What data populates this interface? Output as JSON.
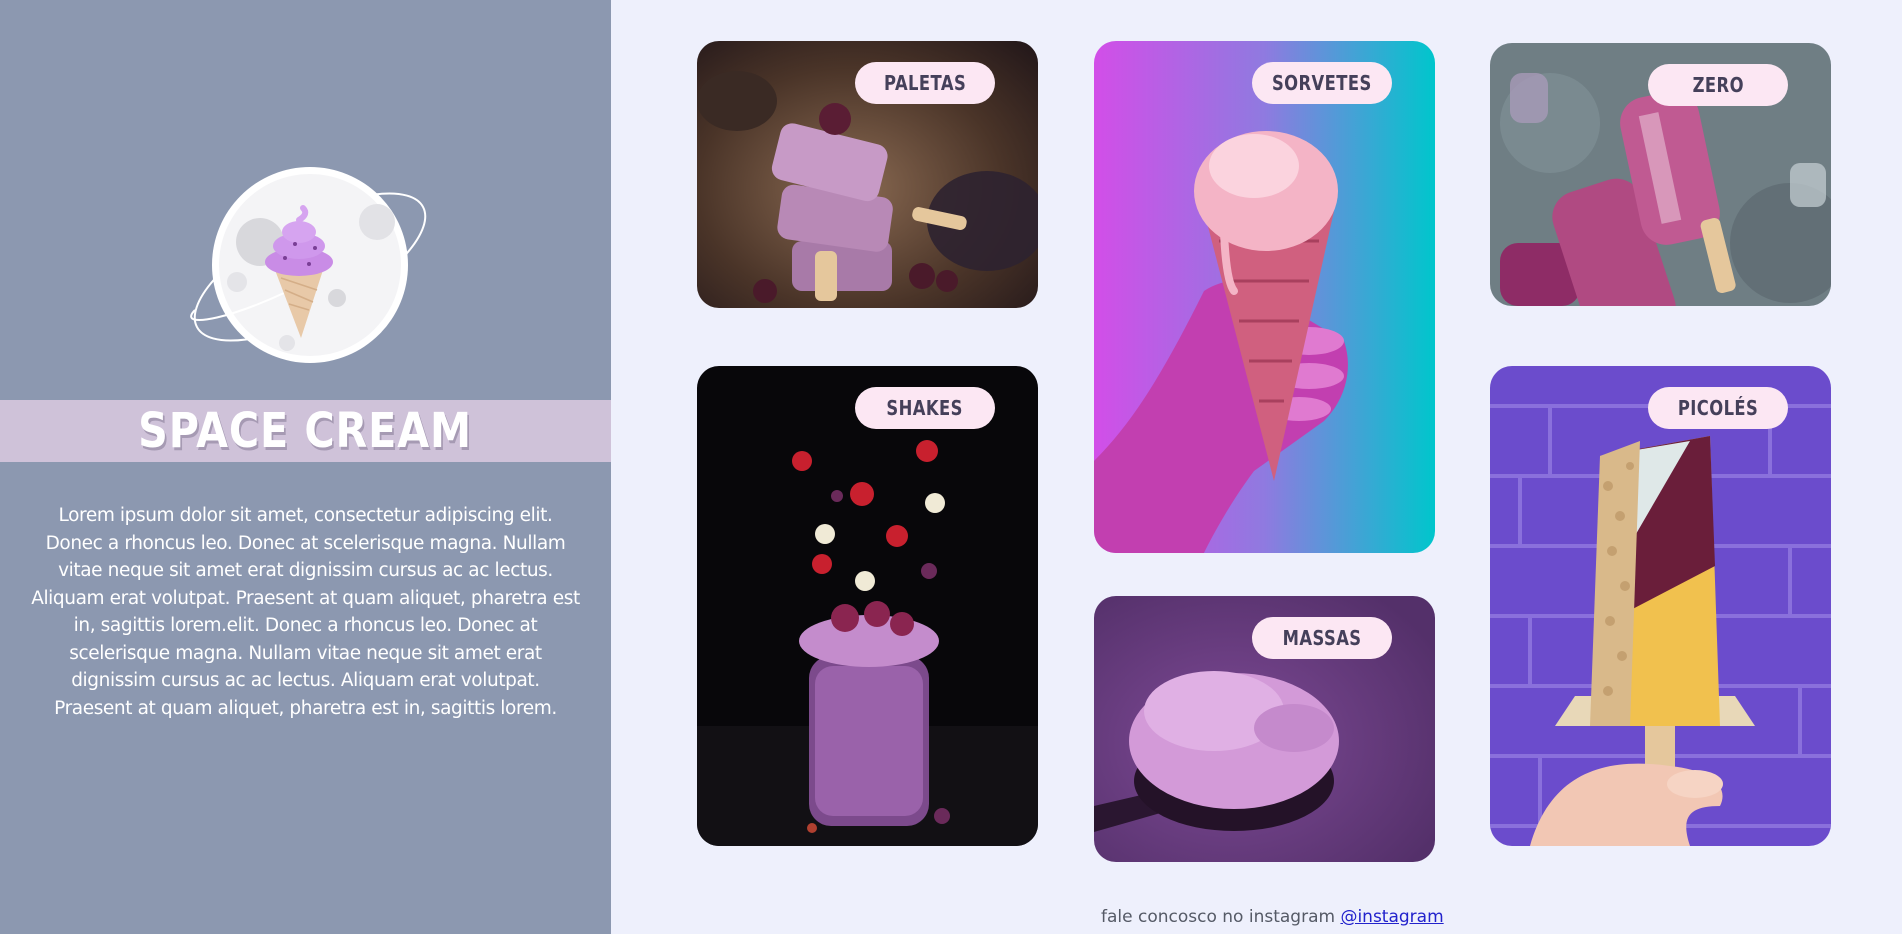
{
  "brand": {
    "title": "SPACE CREAM",
    "logo_icon": "planet-ice-cream-icon",
    "description": "Lorem ipsum dolor sit amet, consectetur adipiscing elit. Donec a rhoncus leo. Donec at scelerisque magna. Nullam vitae neque sit amet erat dignissim cursus ac ac lectus. Aliquam erat volutpat. Praesent at quam aliquet, pharetra est in, sagittis lorem.elit. Donec a rhoncus leo. Donec at scelerisque magna. Nullam vitae neque sit amet erat dignissim cursus ac ac lectus. Aliquam erat volutpat. Praesent at quam aliquet, pharetra est in, sagittis lorem."
  },
  "cards": {
    "paletas": {
      "label": "PALETAS"
    },
    "sorvetes": {
      "label": "SORVETES"
    },
    "zero": {
      "label": "ZERO"
    },
    "shakes": {
      "label": "SHAKES"
    },
    "massas": {
      "label": "MASSAS"
    },
    "picoles": {
      "label": "PICOLÉS"
    }
  },
  "footer": {
    "text": "fale concosco no instagram ",
    "link": "@instagram"
  },
  "colors": {
    "sidebar_bg": "#8c98b0",
    "page_bg": "#eef0fc",
    "brand_band": "#cfc2d9",
    "label_bg": "#fce7f3",
    "label_text": "#45405a"
  }
}
